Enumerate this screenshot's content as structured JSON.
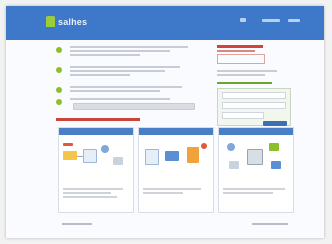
{
  "site": {
    "logo_text": "salhes",
    "colors": {
      "brand_blue": "#3d78c9",
      "accent_green": "#8dbf2a",
      "alert_red": "#d0443a"
    }
  },
  "header": {
    "nav": [
      {
        "label": "",
        "icon": "user-icon"
      },
      {
        "label": "",
        "icon": "link"
      },
      {
        "label": "",
        "icon": "link"
      }
    ]
  },
  "features": [
    {
      "text": ""
    },
    {
      "text": ""
    },
    {
      "text": ""
    },
    {
      "text": ""
    }
  ],
  "cta": {
    "label": ""
  },
  "signup": {
    "title": "",
    "subtitle": "",
    "green_title": "",
    "fields": [
      "",
      "",
      ""
    ],
    "button_label": ""
  },
  "section": {
    "title": ""
  },
  "cards": [
    {
      "title": "",
      "caption": ""
    },
    {
      "title": "",
      "caption": ""
    },
    {
      "title": "",
      "caption": ""
    }
  ],
  "footer": {
    "left_label": "",
    "right_label": ""
  }
}
